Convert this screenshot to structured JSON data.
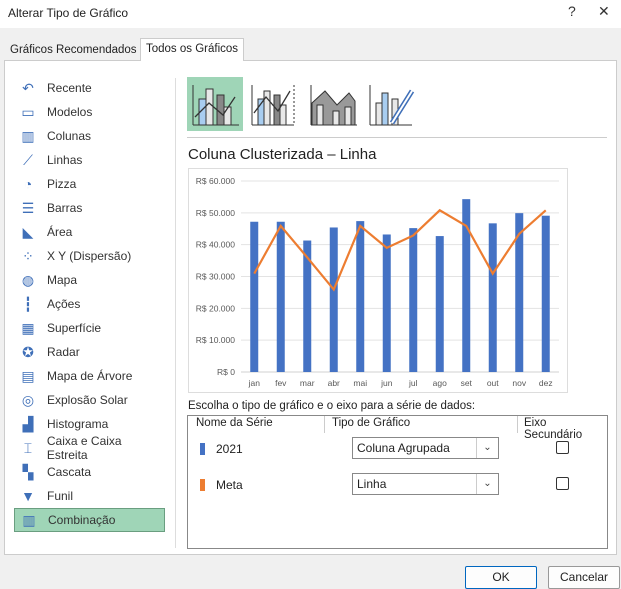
{
  "window": {
    "title": "Alterar Tipo de Gráfico",
    "help": "?",
    "close": "✕"
  },
  "tabs": [
    {
      "label": "Gráficos Recomendados",
      "active": false
    },
    {
      "label": "Todos os Gráficos",
      "active": true
    }
  ],
  "sidebar": {
    "items": [
      {
        "label": "Recente",
        "icon": "undo-icon",
        "glyph": "↶"
      },
      {
        "label": "Modelos",
        "icon": "folder-icon",
        "glyph": "▭"
      },
      {
        "label": "Colunas",
        "icon": "column-chart-icon",
        "glyph": "▥"
      },
      {
        "label": "Linhas",
        "icon": "line-chart-icon",
        "glyph": "⟋"
      },
      {
        "label": "Pizza",
        "icon": "pie-chart-icon",
        "glyph": "◔"
      },
      {
        "label": "Barras",
        "icon": "bar-chart-icon",
        "glyph": "☰"
      },
      {
        "label": "Área",
        "icon": "area-chart-icon",
        "glyph": "◣"
      },
      {
        "label": "X Y (Dispersão)",
        "icon": "scatter-chart-icon",
        "glyph": "⁘"
      },
      {
        "label": "Mapa",
        "icon": "globe-icon",
        "glyph": "◍"
      },
      {
        "label": "Ações",
        "icon": "stock-chart-icon",
        "glyph": "┇"
      },
      {
        "label": "Superfície",
        "icon": "surface-chart-icon",
        "glyph": "▦"
      },
      {
        "label": "Radar",
        "icon": "radar-chart-icon",
        "glyph": "✪"
      },
      {
        "label": "Mapa de Árvore",
        "icon": "treemap-icon",
        "glyph": "▤"
      },
      {
        "label": "Explosão Solar",
        "icon": "sunburst-icon",
        "glyph": "◎"
      },
      {
        "label": "Histograma",
        "icon": "histogram-icon",
        "glyph": "▟"
      },
      {
        "label": "Caixa e Caixa Estreita",
        "icon": "box-whisker-icon",
        "glyph": "⌶"
      },
      {
        "label": "Cascata",
        "icon": "waterfall-icon",
        "glyph": "▚"
      },
      {
        "label": "Funil",
        "icon": "funnel-icon",
        "glyph": "▼"
      },
      {
        "label": "Combinação",
        "icon": "combo-chart-icon",
        "glyph": "▥",
        "selected": true
      }
    ]
  },
  "subtypes": [
    {
      "name": "clustered-column-line",
      "selected": true
    },
    {
      "name": "clustered-column-line-secondary-axis"
    },
    {
      "name": "stacked-area-clustered-column"
    },
    {
      "name": "custom-combination"
    }
  ],
  "chart_title": "Coluna Clusterizada – Linha",
  "chart_data": {
    "type": "bar",
    "categories": [
      "jan",
      "fev",
      "mar",
      "abr",
      "mai",
      "jun",
      "jul",
      "ago",
      "set",
      "out",
      "nov",
      "dez"
    ],
    "series": [
      {
        "name": "2021",
        "type": "bar",
        "color": "#4472c4",
        "values": [
          47200,
          47200,
          41300,
          45400,
          47400,
          43200,
          45200,
          42700,
          54300,
          46700,
          49900,
          49100
        ]
      },
      {
        "name": "Meta",
        "type": "line",
        "color": "#ed7d31",
        "values": [
          30900,
          45900,
          36000,
          25900,
          45900,
          39000,
          42900,
          50800,
          45900,
          30900,
          43400,
          50800
        ]
      }
    ],
    "yticks": [
      "R$ 0",
      "R$ 10.000",
      "R$ 20.000",
      "R$ 30.000",
      "R$ 40.000",
      "R$ 50.000",
      "R$ 60.000"
    ],
    "ylim": [
      0,
      60000
    ],
    "grid": true
  },
  "series_section": {
    "label": "Escolha o tipo de gráfico e o eixo para a série de dados:",
    "headers": [
      "Nome da Série",
      "Tipo de Gráfico",
      "Eixo Secundário"
    ],
    "rows": [
      {
        "name": "2021",
        "color": "#4472c4",
        "type": "Coluna Agrupada",
        "secondary": false
      },
      {
        "name": "Meta",
        "color": "#ed7d31",
        "type": "Linha",
        "secondary": false
      }
    ]
  },
  "buttons": {
    "ok": "OK",
    "cancel": "Cancelar"
  }
}
